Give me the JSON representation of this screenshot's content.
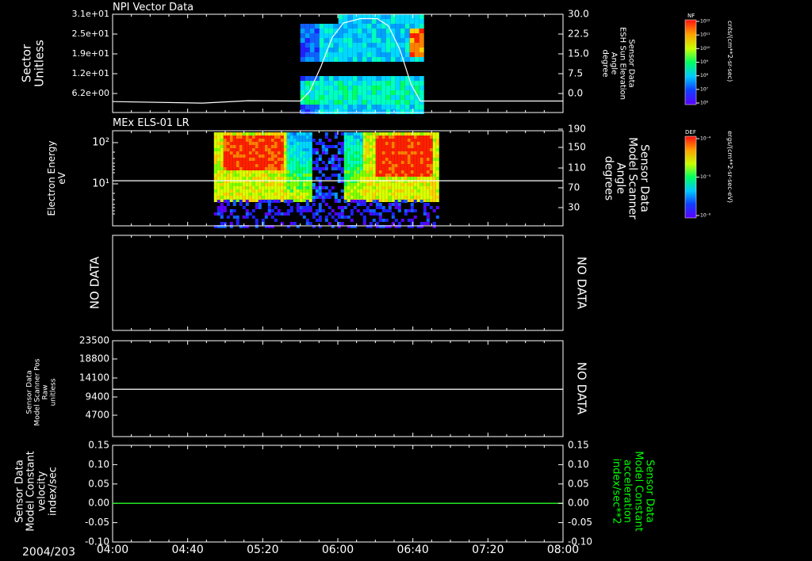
{
  "x_axis": {
    "date": "2004/203",
    "ticks": [
      "04:00",
      "04:40",
      "05:20",
      "06:00",
      "06:40",
      "07:20",
      "08:00"
    ],
    "range_hours": [
      4,
      8
    ]
  },
  "panels": [
    {
      "id": "npi",
      "title": "NPI Vector Data",
      "left_label": [
        "Sector",
        "Unitless"
      ],
      "left_ticks": [
        "3.1e+01",
        "2.5e+01",
        "1.9e+01",
        "1.2e+01",
        "6.2e+00"
      ],
      "right_label": [
        "Sensor Data",
        "ESH Sun Elevation",
        "Angle",
        "degree"
      ],
      "right_ticks": [
        "30.0",
        "22.5",
        "15.0",
        "7.5",
        "0.0"
      ]
    },
    {
      "id": "els",
      "title": "MEx ELS-01 LR",
      "left_label": [
        "Electron Energy",
        "eV"
      ],
      "left_ticks": [
        "10²",
        "10¹"
      ],
      "right_label": [
        "Sensor Data",
        "Model Scanner",
        "Angle",
        "degrees"
      ],
      "right_ticks": [
        "190",
        "150",
        "110",
        "70",
        "30"
      ]
    },
    {
      "id": "empty",
      "left_label": [
        "NO DATA"
      ],
      "right_label": [
        "NO DATA"
      ]
    },
    {
      "id": "scanpos",
      "left_label": [
        "Sensor Data",
        "Model Scanner Pos",
        "Raw",
        "unitless"
      ],
      "left_ticks": [
        "23500",
        "18800",
        "14100",
        "9400",
        "4700"
      ],
      "right_label": [
        "NO DATA"
      ]
    },
    {
      "id": "const",
      "left_label": [
        "Sensor Data",
        "Model Constant",
        "velocity",
        "index/sec"
      ],
      "left_ticks": [
        "0.15",
        "0.10",
        "0.05",
        "0.00",
        "-0.05",
        "-0.10"
      ],
      "right_label": [
        "Sensor Data",
        "Model Constant",
        "acceleration",
        "index/sec**2"
      ],
      "right_ticks": [
        "0.15",
        "0.10",
        "0.05",
        "0.00",
        "-0.05",
        "-0.10"
      ]
    }
  ],
  "colorbars": [
    {
      "id": "nf",
      "tag": "NF",
      "unit": "cnts/(cm**2-sr-sec)",
      "ticks": [
        "10¹²",
        "10¹¹",
        "10¹⁰",
        "10⁹",
        "10⁸",
        "10⁷",
        "10⁶"
      ]
    },
    {
      "id": "def",
      "tag": "DEF",
      "unit": "ergs/(cm**2-sr-sec-eV)",
      "ticks": [
        "10⁻⁴",
        "10⁻⁵",
        "10⁻⁶"
      ]
    }
  ],
  "colors": {
    "background": "#000000",
    "axis": "#ffffff",
    "constant_series": "#00ff00"
  },
  "chart_data": [
    {
      "type": "heatmap",
      "panel": "npi",
      "title": "NPI Vector Data",
      "ylabel": "Sector Unitless",
      "y_ticks": [
        31,
        25,
        19,
        12,
        6.2
      ],
      "data_span_hours": [
        5.667,
        6.733
      ],
      "line_series": {
        "name": "ESH Sun Elevation Angle",
        "axis": "right",
        "ylim": [
          -3.75,
          30
        ],
        "x_hours": [
          4.0,
          4.8,
          5.2,
          5.667,
          5.75,
          5.85,
          5.95,
          6.05,
          6.2,
          6.35,
          6.45,
          6.55,
          6.65,
          6.733,
          8.0
        ],
        "y": [
          0.0,
          -0.5,
          0.3,
          0.2,
          3.5,
          12.0,
          22.0,
          27.0,
          28.5,
          28.5,
          26.0,
          18.0,
          6.0,
          0.2,
          0.2
        ]
      }
    },
    {
      "type": "heatmap",
      "panel": "els",
      "title": "MEx ELS-01 LR",
      "ylabel": "Electron Energy eV",
      "ylog": true,
      "data_span_hours": [
        4.9,
        6.9
      ],
      "line_series": {
        "name": "Model Scanner Angle",
        "axis": "right",
        "ylim": [
          0,
          190
        ],
        "x_hours": [
          4.0,
          8.0
        ],
        "y": [
          90,
          90
        ]
      }
    },
    {
      "type": "line",
      "panel": "scanpos",
      "ylabel": "Sensor Data Model Scanner Pos Raw unitless",
      "ylim": [
        0,
        23500
      ],
      "x_hours": [
        4.0,
        8.0
      ],
      "y": [
        11600,
        11600
      ]
    },
    {
      "type": "line",
      "panel": "const",
      "ylabel": "Sensor Data Model Constant velocity index/sec",
      "ylim": [
        -0.1,
        0.15
      ],
      "series": [
        {
          "name": "velocity",
          "x_hours": [
            4.0,
            8.0
          ],
          "y": [
            0.0,
            0.0
          ]
        },
        {
          "name": "acceleration",
          "x_hours": [
            4.0,
            8.0
          ],
          "y": [
            0.0,
            0.0
          ]
        }
      ]
    }
  ]
}
